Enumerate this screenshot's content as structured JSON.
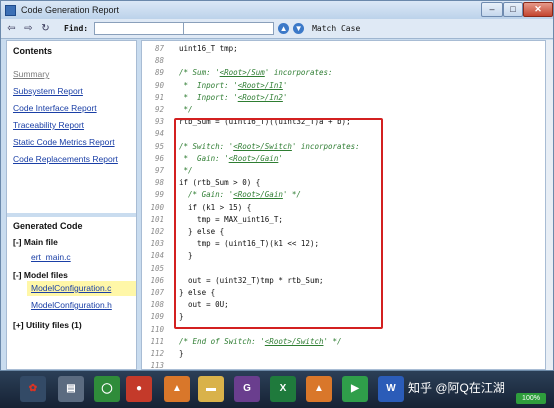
{
  "window": {
    "title": "Code Generation Report"
  },
  "toolbar": {
    "find_label": "Find:",
    "match_case_label": "Match Case"
  },
  "nav": {
    "contents_title": "Contents",
    "links": [
      "Summary",
      "Subsystem Report",
      "Code Interface Report",
      "Traceability Report",
      "Static Code Metrics Report",
      "Code Replacements Report"
    ],
    "generated_title": "Generated Code",
    "main_file": {
      "toggle": "[-]",
      "label": "Main file",
      "files": [
        "ert_main.c"
      ]
    },
    "model_files": {
      "toggle": "[-]",
      "label": "Model files",
      "files": [
        "ModelConfiguration.c",
        "ModelConfiguration.h"
      ]
    },
    "utility_files": {
      "toggle": "[+]",
      "label": "Utility files (1)"
    }
  },
  "code_lines": [
    {
      "n": "87",
      "t": "uint16_T tmp;"
    },
    {
      "n": "88",
      "t": ""
    },
    {
      "n": "89",
      "t": "/* Sum: '<Root>/Sum' incorporates:"
    },
    {
      "n": "90",
      "t": " *  Inport: '<Root>/In1'"
    },
    {
      "n": "91",
      "t": " *  Inport: '<Root>/In2'"
    },
    {
      "n": "92",
      "t": " */"
    },
    {
      "n": "93",
      "t": "rtb_Sum = (uint16_T)((uint32_T)a + b);"
    },
    {
      "n": "94",
      "t": ""
    },
    {
      "n": "95",
      "t": "/* Switch: '<Root>/Switch' incorporates:"
    },
    {
      "n": "96",
      "t": " *  Gain: '<Root>/Gain'"
    },
    {
      "n": "97",
      "t": " */"
    },
    {
      "n": "98",
      "t": "if (rtb_Sum > 0) {"
    },
    {
      "n": "99",
      "t": "  /* Gain: '<Root>/Gain' */"
    },
    {
      "n": "100",
      "t": "  if (k1 > 15) {"
    },
    {
      "n": "101",
      "t": "    tmp = MAX_uint16_T;"
    },
    {
      "n": "102",
      "t": "  } else {"
    },
    {
      "n": "103",
      "t": "    tmp = (uint16_T)(k1 << 12);"
    },
    {
      "n": "104",
      "t": "  }"
    },
    {
      "n": "105",
      "t": ""
    },
    {
      "n": "106",
      "t": "  out = (uint32_T)tmp * rtb_Sum;"
    },
    {
      "n": "107",
      "t": "} else {"
    },
    {
      "n": "108",
      "t": "  out = 0U;"
    },
    {
      "n": "109",
      "t": "}"
    },
    {
      "n": "110",
      "t": ""
    },
    {
      "n": "111",
      "t": "/* End of Switch: '<Root>/Switch' */"
    },
    {
      "n": "112",
      "t": "}"
    },
    {
      "n": "113",
      "t": ""
    }
  ],
  "taskbar": {
    "watermark": "知乎 @阿Q在江湖",
    "tray_badge": "100%"
  }
}
